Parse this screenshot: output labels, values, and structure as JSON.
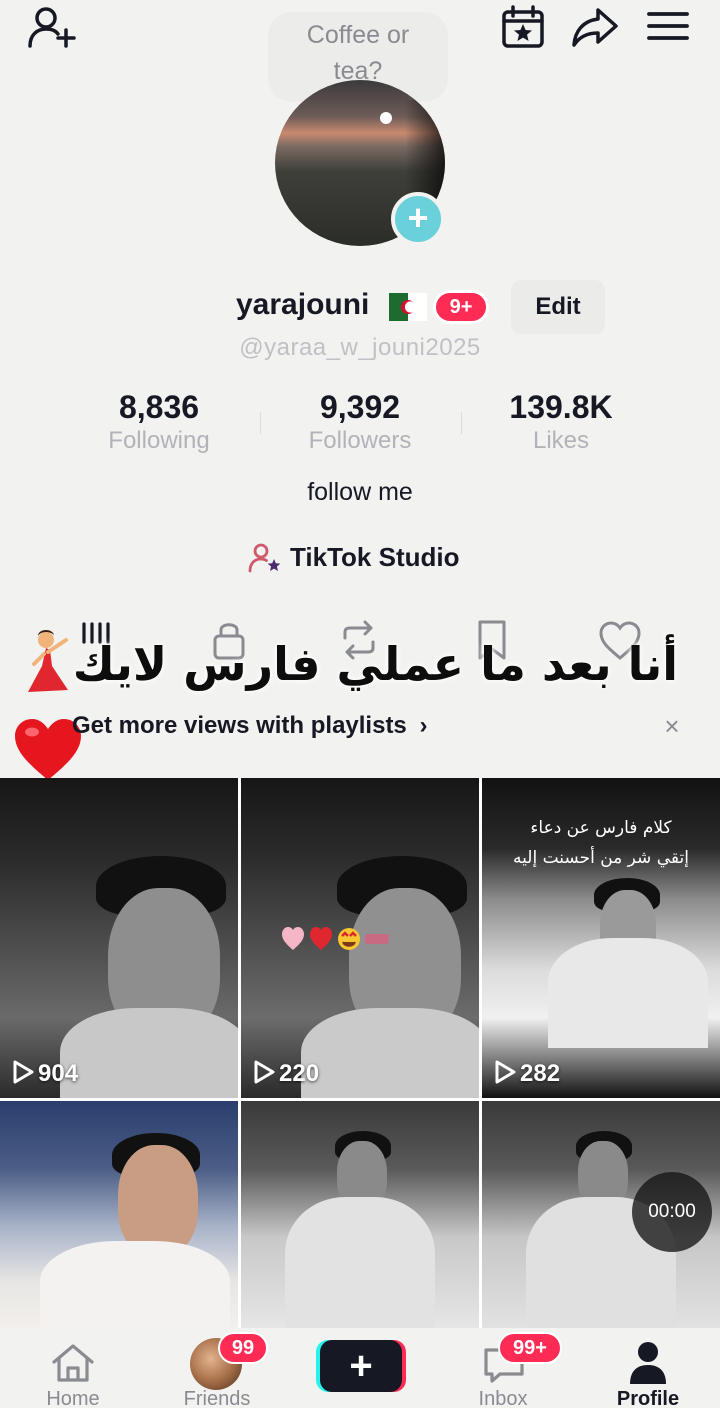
{
  "top_bar": {
    "add_friend_icon": "add-user-icon",
    "calendar_icon": "calendar-star-icon",
    "share_icon": "share-arrow-icon",
    "menu_icon": "hamburger-menu-icon"
  },
  "note_bubble": {
    "line1": "Coffee or",
    "line2": "tea?"
  },
  "profile": {
    "username": "yarajouni",
    "notification_badge": "9+",
    "edit_label": "Edit",
    "handle": "@yaraa_w_jouni2025",
    "bio": "follow me",
    "studio_label": "TikTok Studio"
  },
  "stats": [
    {
      "value": "8,836",
      "label": "Following"
    },
    {
      "value": "9,392",
      "label": "Followers"
    },
    {
      "value": "139.8K",
      "label": "Likes"
    }
  ],
  "overlay_caption": "أنا بعد ما عملي فارس لايك",
  "playlist_banner": {
    "text": "Get more views with playlists",
    "chevron": "›",
    "close": "×"
  },
  "videos": [
    {
      "views": "904"
    },
    {
      "views": "220"
    },
    {
      "views": "282",
      "caption_line1": "كلام فارس عن دعاء",
      "caption_line2": "إتقي شر من أحسنت إليه"
    },
    {},
    {},
    {
      "timer": "00:00"
    }
  ],
  "bottom_nav": [
    {
      "label": "Home",
      "icon": "home-icon"
    },
    {
      "label": "Friends",
      "badge": "99"
    },
    {
      "label": "",
      "icon": "plus-icon",
      "symbol": "+"
    },
    {
      "label": "Inbox",
      "badge": "99+",
      "icon": "inbox-icon"
    },
    {
      "label": "Profile",
      "icon": "profile-icon"
    }
  ],
  "colors": {
    "accent_red": "#fe2c55",
    "accent_cyan": "#25f4ee",
    "text_primary": "#161823",
    "text_secondary": "#8a8b91"
  }
}
